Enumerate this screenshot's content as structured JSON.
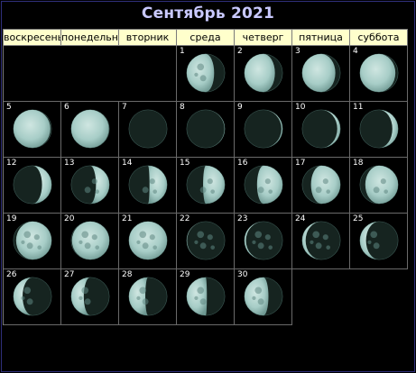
{
  "title": "Сентябрь 2021",
  "weekdays": [
    "воскресень",
    "понедельни",
    "вторник",
    "среда",
    "четверг",
    "пятница",
    "суббота"
  ],
  "first_weekday_index": 3,
  "colors": {
    "background": "#000000",
    "header_bg": "#ffffcc",
    "title": "#c9c9ff",
    "moon_lit": "#a7cdc7",
    "moon_dark": "#162420"
  },
  "days": [
    {
      "day": "1",
      "phase": 0.28
    },
    {
      "day": "2",
      "phase": 0.2
    },
    {
      "day": "3",
      "phase": 0.13
    },
    {
      "day": "4",
      "phase": 0.07
    },
    {
      "day": "5",
      "phase": 0.03
    },
    {
      "day": "6",
      "phase": 0.01
    },
    {
      "day": "7",
      "phase": 0.0
    },
    {
      "day": "8",
      "phase": 0.01
    },
    {
      "day": "9",
      "phase": 0.03
    },
    {
      "day": "10",
      "phase": 0.08
    },
    {
      "day": "11",
      "phase": 0.15
    },
    {
      "day": "12",
      "phase": 0.25
    },
    {
      "day": "13",
      "phase": 0.35
    },
    {
      "day": "14",
      "phase": 0.46
    },
    {
      "day": "15",
      "phase": 0.57
    },
    {
      "day": "16",
      "phase": 0.67
    },
    {
      "day": "17",
      "phase": 0.77
    },
    {
      "day": "18",
      "phase": 0.86
    },
    {
      "day": "19",
      "phase": 0.93
    },
    {
      "day": "20",
      "phase": 0.98
    },
    {
      "day": "21",
      "phase": 1.0
    },
    {
      "day": "22",
      "phase": 0.99
    },
    {
      "day": "23",
      "phase": 0.96
    },
    {
      "day": "24",
      "phase": 0.91
    },
    {
      "day": "25",
      "phase": 0.84
    },
    {
      "day": "26",
      "phase": 0.76
    },
    {
      "day": "27",
      "phase": 0.67
    },
    {
      "day": "28",
      "phase": 0.57
    },
    {
      "day": "29",
      "phase": 0.47
    },
    {
      "day": "30",
      "phase": 0.37
    }
  ]
}
